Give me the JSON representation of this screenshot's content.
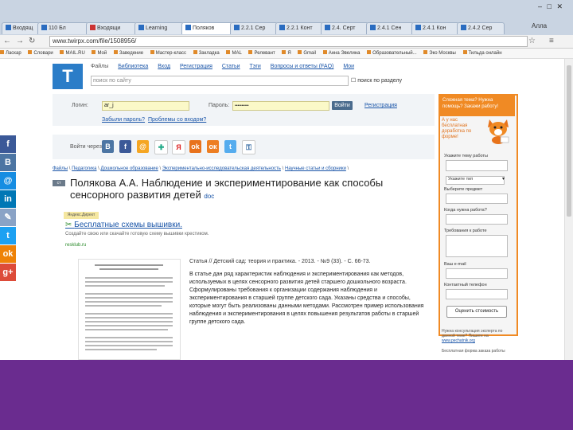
{
  "browser": {
    "tabs": [
      {
        "label": "Входящ"
      },
      {
        "label": "110 Бл"
      },
      {
        "label": "Входящи"
      },
      {
        "label": "Learning"
      },
      {
        "label": "Поляков"
      },
      {
        "label": "2.2.1 Сер"
      },
      {
        "label": "2.2.1 Конт"
      },
      {
        "label": "2.4. Серт"
      },
      {
        "label": "2.4.1 Сен"
      },
      {
        "label": "2.4.1 Кон"
      },
      {
        "label": "2.4.2 Сер"
      }
    ],
    "user_badge": "Алла",
    "url": "www.twirpx.com/file/1508956/",
    "bookmarks": [
      "Ласкар",
      "Словари",
      "MAIL.RU",
      "Мой",
      "Заведение",
      "Мастер-класс",
      "Закладка",
      "МАL",
      "Релевант",
      "Я",
      "Gmail",
      "Анна Эвелина",
      "Образовательный...",
      "Эко Москвы",
      "Тильда онлайн"
    ]
  },
  "site": {
    "logo_letter": "T",
    "menu": [
      "Файлы",
      "Библиотека",
      "Вход",
      "Регистрация",
      "Статьи",
      "Тэги",
      "Вопросы и ответы (FAQ)",
      "Мои"
    ],
    "search_placeholder": "поиск по сайту",
    "search_button": "поиск по разделу",
    "login_label": "Логин:",
    "login_value": "ar_j",
    "password_label": "Пароль:",
    "password_value": "••••••••••",
    "enter_button": "Войти",
    "register_link": "Регистрация",
    "forgot_link": "Забыли пароль?",
    "reset_link": "Проблемы со входом?",
    "social_label": "Войти через:",
    "breadcrumb": [
      "Файлы",
      "Педагогика",
      "Дошкольное образование",
      "Экспериментально-исследовательская деятельность",
      "Научные статьи и сборники"
    ],
    "title_badge": "ст",
    "title": "Полякова А.А. Наблюдение и экспериментирование как способы сенсорного развития детей",
    "title_format": "doc",
    "promo_tag": "Яндекс.Директ",
    "promo_title": "Бесплатные схемы вышивки.",
    "promo_text": "Создайте свою или скачайте готовую схему вышивки крестиком.",
    "promo_link": "resklub.ru",
    "citation": "Статья // Детский сад: теория и практика. - 2013. - №9 (33). - С. 66-73.",
    "abstract": "В статье дан ряд характеристик наблюдения и экспериментирования как методов, используемых в целях сенсорного развития детей старшего дошкольного возраста. Сформулированы требования к организации содержания наблюдения и экспериментирования в старшей группе детского сада. Указаны средства и способы, которые могут быть реализованы данными методами. Рассмотрен пример использования наблюдения и экспериментирования в целях повышения результатов работы в старшей группе детского сада."
  },
  "side_form": {
    "heading": "Сложная тема? Нужна помощь? Закажи работу!",
    "promo": "А у нас бесплатная доработка по форме!",
    "fields": [
      {
        "label": "Укажите тему работы"
      },
      {
        "label": "Укажите тип"
      },
      {
        "label": "Выберите предмет"
      },
      {
        "label": "Когда нужна работа?"
      },
      {
        "label": "Требования к работе"
      },
      {
        "label": "Ваш e-mail"
      },
      {
        "label": "Контактный телефон"
      }
    ],
    "type_value": "Укажите тип",
    "submit": "Оценить стоимость",
    "footer1": "Нужна консультация эксперта по данной теме? Пишите на",
    "footer_link": "www.pechatnik.org",
    "footer2": "Бесплатная форма заказа работы"
  }
}
